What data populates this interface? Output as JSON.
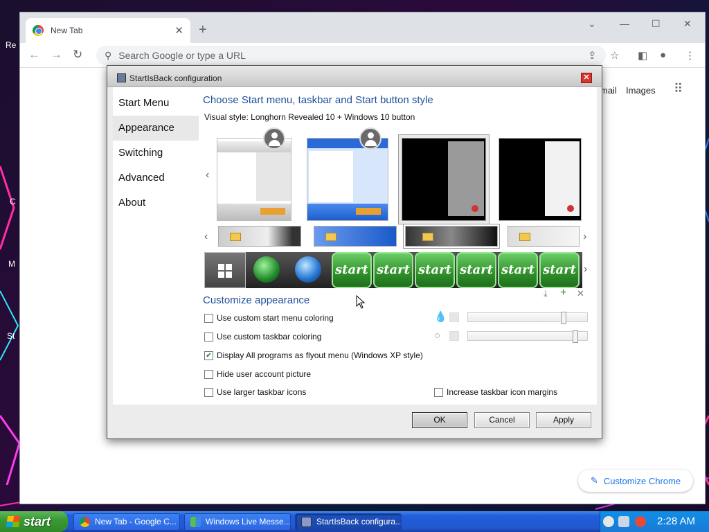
{
  "desktop": {
    "left_labels": [
      "Re",
      "C",
      "M",
      "St"
    ]
  },
  "chrome": {
    "tab_title": "New Tab",
    "tab_close": "✕",
    "new_tab": "+",
    "omnibox_placeholder": "Search Google or type a URL",
    "ntp_gmail": "mail",
    "ntp_images": "Images",
    "customize_label": "Customize Chrome"
  },
  "dialog": {
    "title": "StartIsBack configuration",
    "sidebar": [
      {
        "label": "Start Menu"
      },
      {
        "label": "Appearance"
      },
      {
        "label": "Switching"
      },
      {
        "label": "Advanced"
      },
      {
        "label": "About"
      }
    ],
    "section_style_title": "Choose Start menu, taskbar and Start button style",
    "visual_style_label": "Visual style:  Longhorn Revealed 10 + Windows 10 button",
    "start_button_label": "start",
    "section_customize_title": "Customize appearance",
    "checkboxes": [
      {
        "label": "Use custom start menu coloring",
        "checked": false
      },
      {
        "label": "Use custom taskbar coloring",
        "checked": false
      },
      {
        "label": "Display All programs as flyout menu (Windows XP style)",
        "checked": true
      },
      {
        "label": "Hide user account picture",
        "checked": false
      },
      {
        "label": "Use larger taskbar icons",
        "checked": false
      },
      {
        "label": "Increase taskbar icon margins",
        "checked": false
      }
    ],
    "sliders": [
      {
        "icon": "ink-drop-filled-icon",
        "value": 0.8
      },
      {
        "icon": "ink-drop-outline-icon",
        "value": 0.9
      }
    ],
    "buttons": {
      "ok": "OK",
      "cancel": "Cancel",
      "apply": "Apply"
    }
  },
  "taskbar": {
    "start_label": "start",
    "tasks": [
      {
        "label": "New Tab - Google C...",
        "active": false
      },
      {
        "label": "Windows Live Messe...",
        "active": false
      },
      {
        "label": "StartIsBack configura...",
        "active": true
      }
    ],
    "clock": "2:28 AM"
  }
}
